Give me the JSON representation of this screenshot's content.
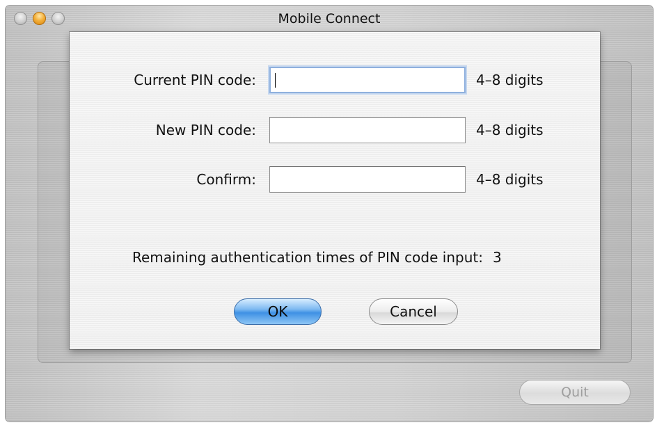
{
  "window": {
    "title": "Mobile Connect",
    "quit_label": "Quit"
  },
  "dialog": {
    "fields": [
      {
        "label": "Current PIN code:",
        "value": "",
        "hint": "4–8 digits",
        "focused": true
      },
      {
        "label": "New PIN code:",
        "value": "",
        "hint": "4–8 digits",
        "focused": false
      },
      {
        "label": "Confirm:",
        "value": "",
        "hint": "4–8 digits",
        "focused": false
      }
    ],
    "remaining_label": "Remaining authentication times of PIN code input:",
    "remaining_count": "3",
    "ok_label": "OK",
    "cancel_label": "Cancel"
  },
  "colors": {
    "ok_button": "#4a98e6",
    "focus_ring": "#8fb0dd",
    "minimize_button": "#f4b13d"
  }
}
